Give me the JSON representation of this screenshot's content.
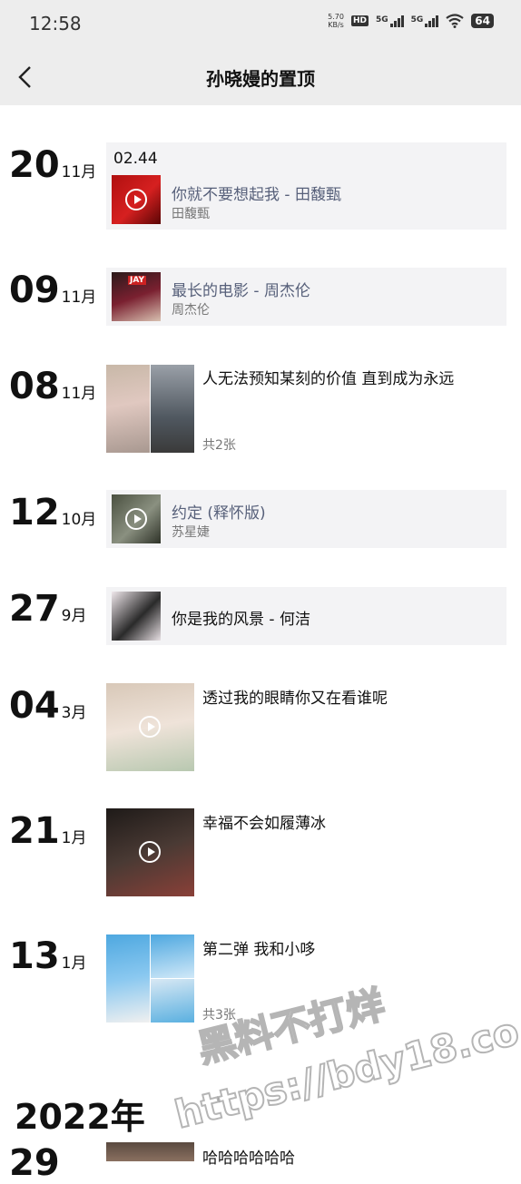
{
  "status_bar": {
    "time": "12:58",
    "net_speed_value": "5.70",
    "net_speed_unit": "KB/s",
    "hd_label": "HD",
    "sim1_label": "5G",
    "sim2_label": "5G",
    "battery": "64"
  },
  "nav": {
    "title": "孙晓嫚的置顶"
  },
  "entries": [
    {
      "day": "20",
      "month": "11月",
      "header": "02.44",
      "title": "你就不要想起我 - 田馥甄",
      "artist": "田馥甄"
    },
    {
      "day": "09",
      "month": "11月",
      "title": "最长的电影 - 周杰伦",
      "artist": "周杰伦",
      "cover_text": "JAY"
    },
    {
      "day": "08",
      "month": "11月",
      "text": "人无法预知某刻的价值 直到成为永远",
      "count": "共2张"
    },
    {
      "day": "12",
      "month": "10月",
      "title": "约定 (释怀版)",
      "artist": "苏星婕"
    },
    {
      "day": "27",
      "month": "9月",
      "title": "你是我的风景 - 何洁"
    },
    {
      "day": "04",
      "month": "3月",
      "text": "透过我的眼睛你又在看谁呢"
    },
    {
      "day": "21",
      "month": "1月",
      "text": "幸福不会如履薄冰"
    },
    {
      "day": "13",
      "month": "1月",
      "text": "第二弹 我和小哆",
      "count": "共3张"
    },
    {
      "day": "29",
      "text": "哈哈哈哈哈哈"
    }
  ],
  "year_header": "2022年",
  "watermark": {
    "line1": "黑料不打烊",
    "line2": "https://bdy18.co"
  },
  "colors": {
    "bar_bg": "#ededed",
    "card_bg": "#f3f3f5",
    "music_title": "#57607a",
    "secondary_text": "#777777"
  }
}
